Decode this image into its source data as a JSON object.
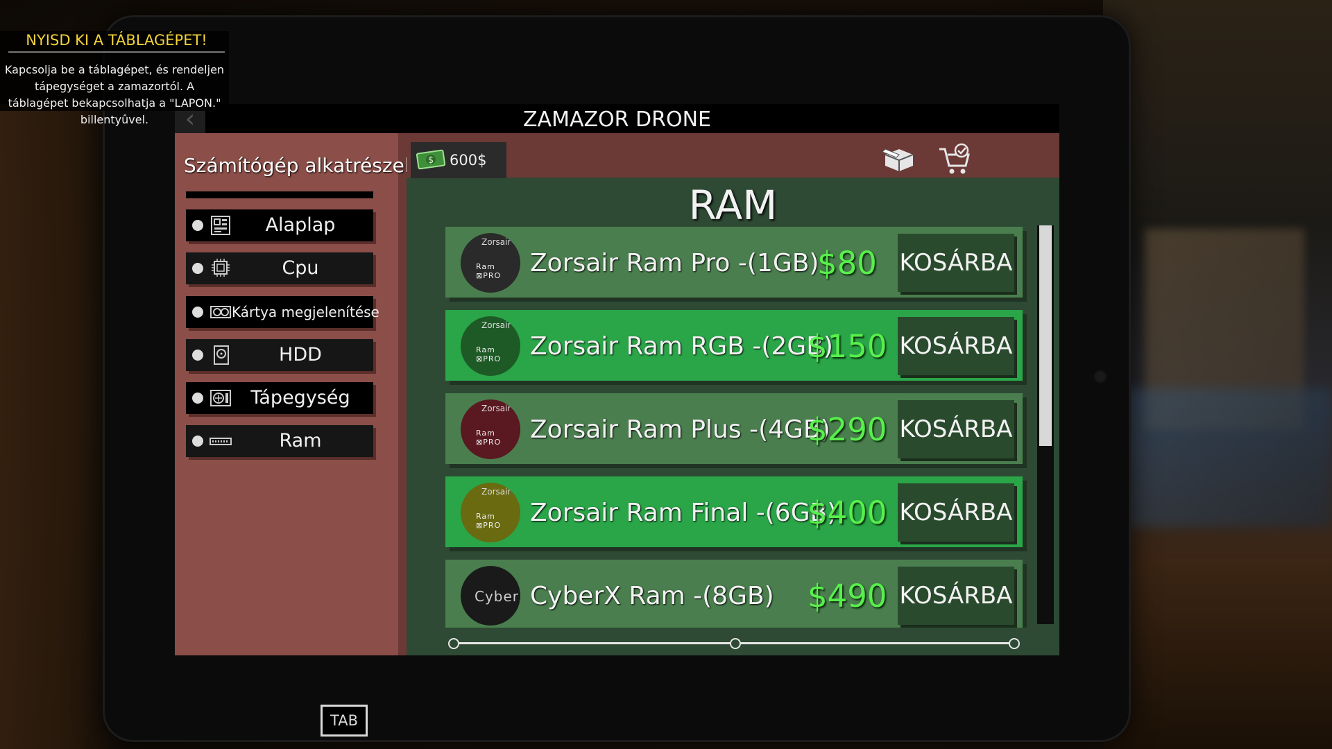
{
  "tooltip": {
    "title": "NYISD KI A TÁBLAGÉPET!",
    "body": "Kapcsolja be a táblagépet, és rendeljen tápegységet a zamazortól. A táblagépet bekapcsolhatja a \"LAPON.\" billentyûvel."
  },
  "app": {
    "title": "ZAMAZOR DRONE"
  },
  "sidebar": {
    "title": "Számítógép alkatrészek",
    "categories": [
      {
        "label": "Alaplap",
        "icon": "motherboard-icon"
      },
      {
        "label": "Cpu",
        "icon": "cpu-icon"
      },
      {
        "label": "Kártya megjelenítése",
        "icon": "graphics-card-icon"
      },
      {
        "label": "HDD",
        "icon": "hdd-icon"
      },
      {
        "label": "Tápegység",
        "icon": "power-supply-icon"
      },
      {
        "label": "Ram",
        "icon": "ram-icon"
      }
    ]
  },
  "wallet": {
    "balance": "600$"
  },
  "toolbar": {
    "box_icon": "package-icon",
    "cart_icon": "cart-check-icon"
  },
  "main": {
    "heading": "RAM",
    "products": [
      {
        "name": "Zorsair Ram Pro -(1GB)",
        "price": "$80",
        "button": "KOSÁRBA",
        "logo_top": "Zorsair",
        "logo_mid": "Ram  ⊠PRO",
        "highlight": false,
        "logo_color": "#2a2a2a"
      },
      {
        "name": "Zorsair Ram RGB -(2GB)",
        "price": "$150",
        "button": "KOSÁRBA",
        "logo_top": "Zorsair",
        "logo_mid": "Ram  ⊠PRO",
        "highlight": true,
        "logo_color": "#1e5a26"
      },
      {
        "name": "Zorsair Ram Plus -(4GB)",
        "price": "$290",
        "button": "KOSÁRBA",
        "logo_top": "Zorsair",
        "logo_mid": "Ram  ⊠PRO",
        "highlight": false,
        "logo_color": "#5a1820"
      },
      {
        "name": "Zorsair Ram Final -(6GB)",
        "price": "$400",
        "button": "KOSÁRBA",
        "logo_top": "Zorsair",
        "logo_mid": "Ram  ⊠PRO",
        "highlight": true,
        "logo_color": "#6a6a10"
      },
      {
        "name": "CyberX Ram -(8GB)",
        "price": "$490",
        "button": "KOSÁRBA",
        "logo_top": "",
        "logo_mid": "CyberX",
        "highlight": false,
        "logo_color": "#1a1a1a"
      }
    ]
  },
  "hint": {
    "tab_key": "TAB"
  }
}
